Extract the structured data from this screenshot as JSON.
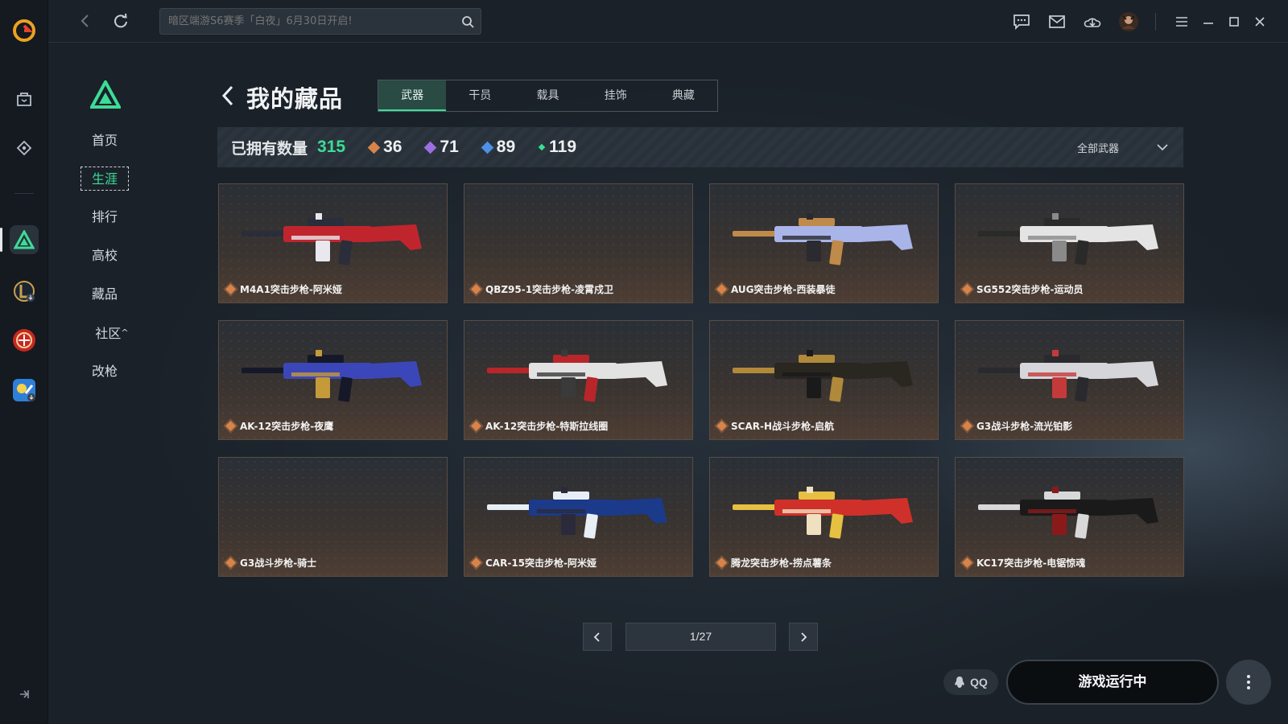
{
  "topbar": {
    "search_placeholder": "暗区端游S6赛季「白夜」6月30日开启!"
  },
  "subnav": {
    "items": [
      {
        "label": "首页",
        "active": false
      },
      {
        "label": "生涯",
        "active": true
      },
      {
        "label": "排行",
        "active": false
      },
      {
        "label": "高校",
        "active": false
      },
      {
        "label": "藏品",
        "active": false
      },
      {
        "label": "社区",
        "active": false
      },
      {
        "label": "改枪",
        "active": false
      }
    ],
    "community_chevron": "^"
  },
  "header": {
    "title": "我的藏品",
    "tabs": [
      {
        "label": "武器",
        "active": true
      },
      {
        "label": "干员",
        "active": false
      },
      {
        "label": "载具",
        "active": false
      },
      {
        "label": "挂饰",
        "active": false
      },
      {
        "label": "典藏",
        "active": false
      }
    ]
  },
  "stats": {
    "owned_label": "已拥有数量",
    "owned_total": "315",
    "tiers": [
      {
        "count": "36",
        "color": "#d7834a"
      },
      {
        "count": "71",
        "color": "#9b6fe0"
      },
      {
        "count": "89",
        "color": "#4e8fe8"
      },
      {
        "count": "119",
        "color": "#3ddc97"
      }
    ],
    "filter_label": "全部武器"
  },
  "items": [
    {
      "name": "M4A1突击步枪-阿米娅",
      "colors": [
        "#c0252e",
        "#2a2d3a",
        "#e8e8ee"
      ]
    },
    {
      "name": "QBZ95-1突击步枪-凌霄戍卫",
      "colors": null
    },
    {
      "name": "AUG突击步枪-西装暴徒",
      "colors": [
        "#a9b4e8",
        "#c08a4a",
        "#2a2a30"
      ]
    },
    {
      "name": "SG552突击步枪-运动员",
      "colors": [
        "#e4e4e4",
        "#2a2a2a",
        "#8a8a8a"
      ]
    },
    {
      "name": "AK-12突击步枪-夜鹰",
      "colors": [
        "#3b47b8",
        "#151828",
        "#c49a3a"
      ]
    },
    {
      "name": "AK-12突击步枪-特斯拉线圈",
      "colors": [
        "#e2e2e2",
        "#b8262a",
        "#3a3a3a"
      ]
    },
    {
      "name": "SCAR-H战斗步枪-启航",
      "colors": [
        "#2a2620",
        "#b08a3a",
        "#1a1a1a"
      ]
    },
    {
      "name": "G3战斗步枪-流光铂影",
      "colors": [
        "#d6d6da",
        "#2a2a2e",
        "#c43a3a"
      ]
    },
    {
      "name": "G3战斗步枪-骑士",
      "colors": null
    },
    {
      "name": "CAR-15突击步枪-阿米娅",
      "colors": [
        "#1b3a8a",
        "#e8eef5",
        "#2a2a3a"
      ]
    },
    {
      "name": "腾龙突击步枪-捞点薯条",
      "colors": [
        "#d0302a",
        "#e6c040",
        "#f0e0c0"
      ]
    },
    {
      "name": "KC17突击步枪-电锯惊魂",
      "colors": [
        "#1a1a1a",
        "#d8d8d8",
        "#8a1a1a"
      ]
    }
  ],
  "pagination": {
    "indicator": "1/27"
  },
  "actions": {
    "qq_label": "QQ",
    "run_label": "游戏运行中"
  }
}
